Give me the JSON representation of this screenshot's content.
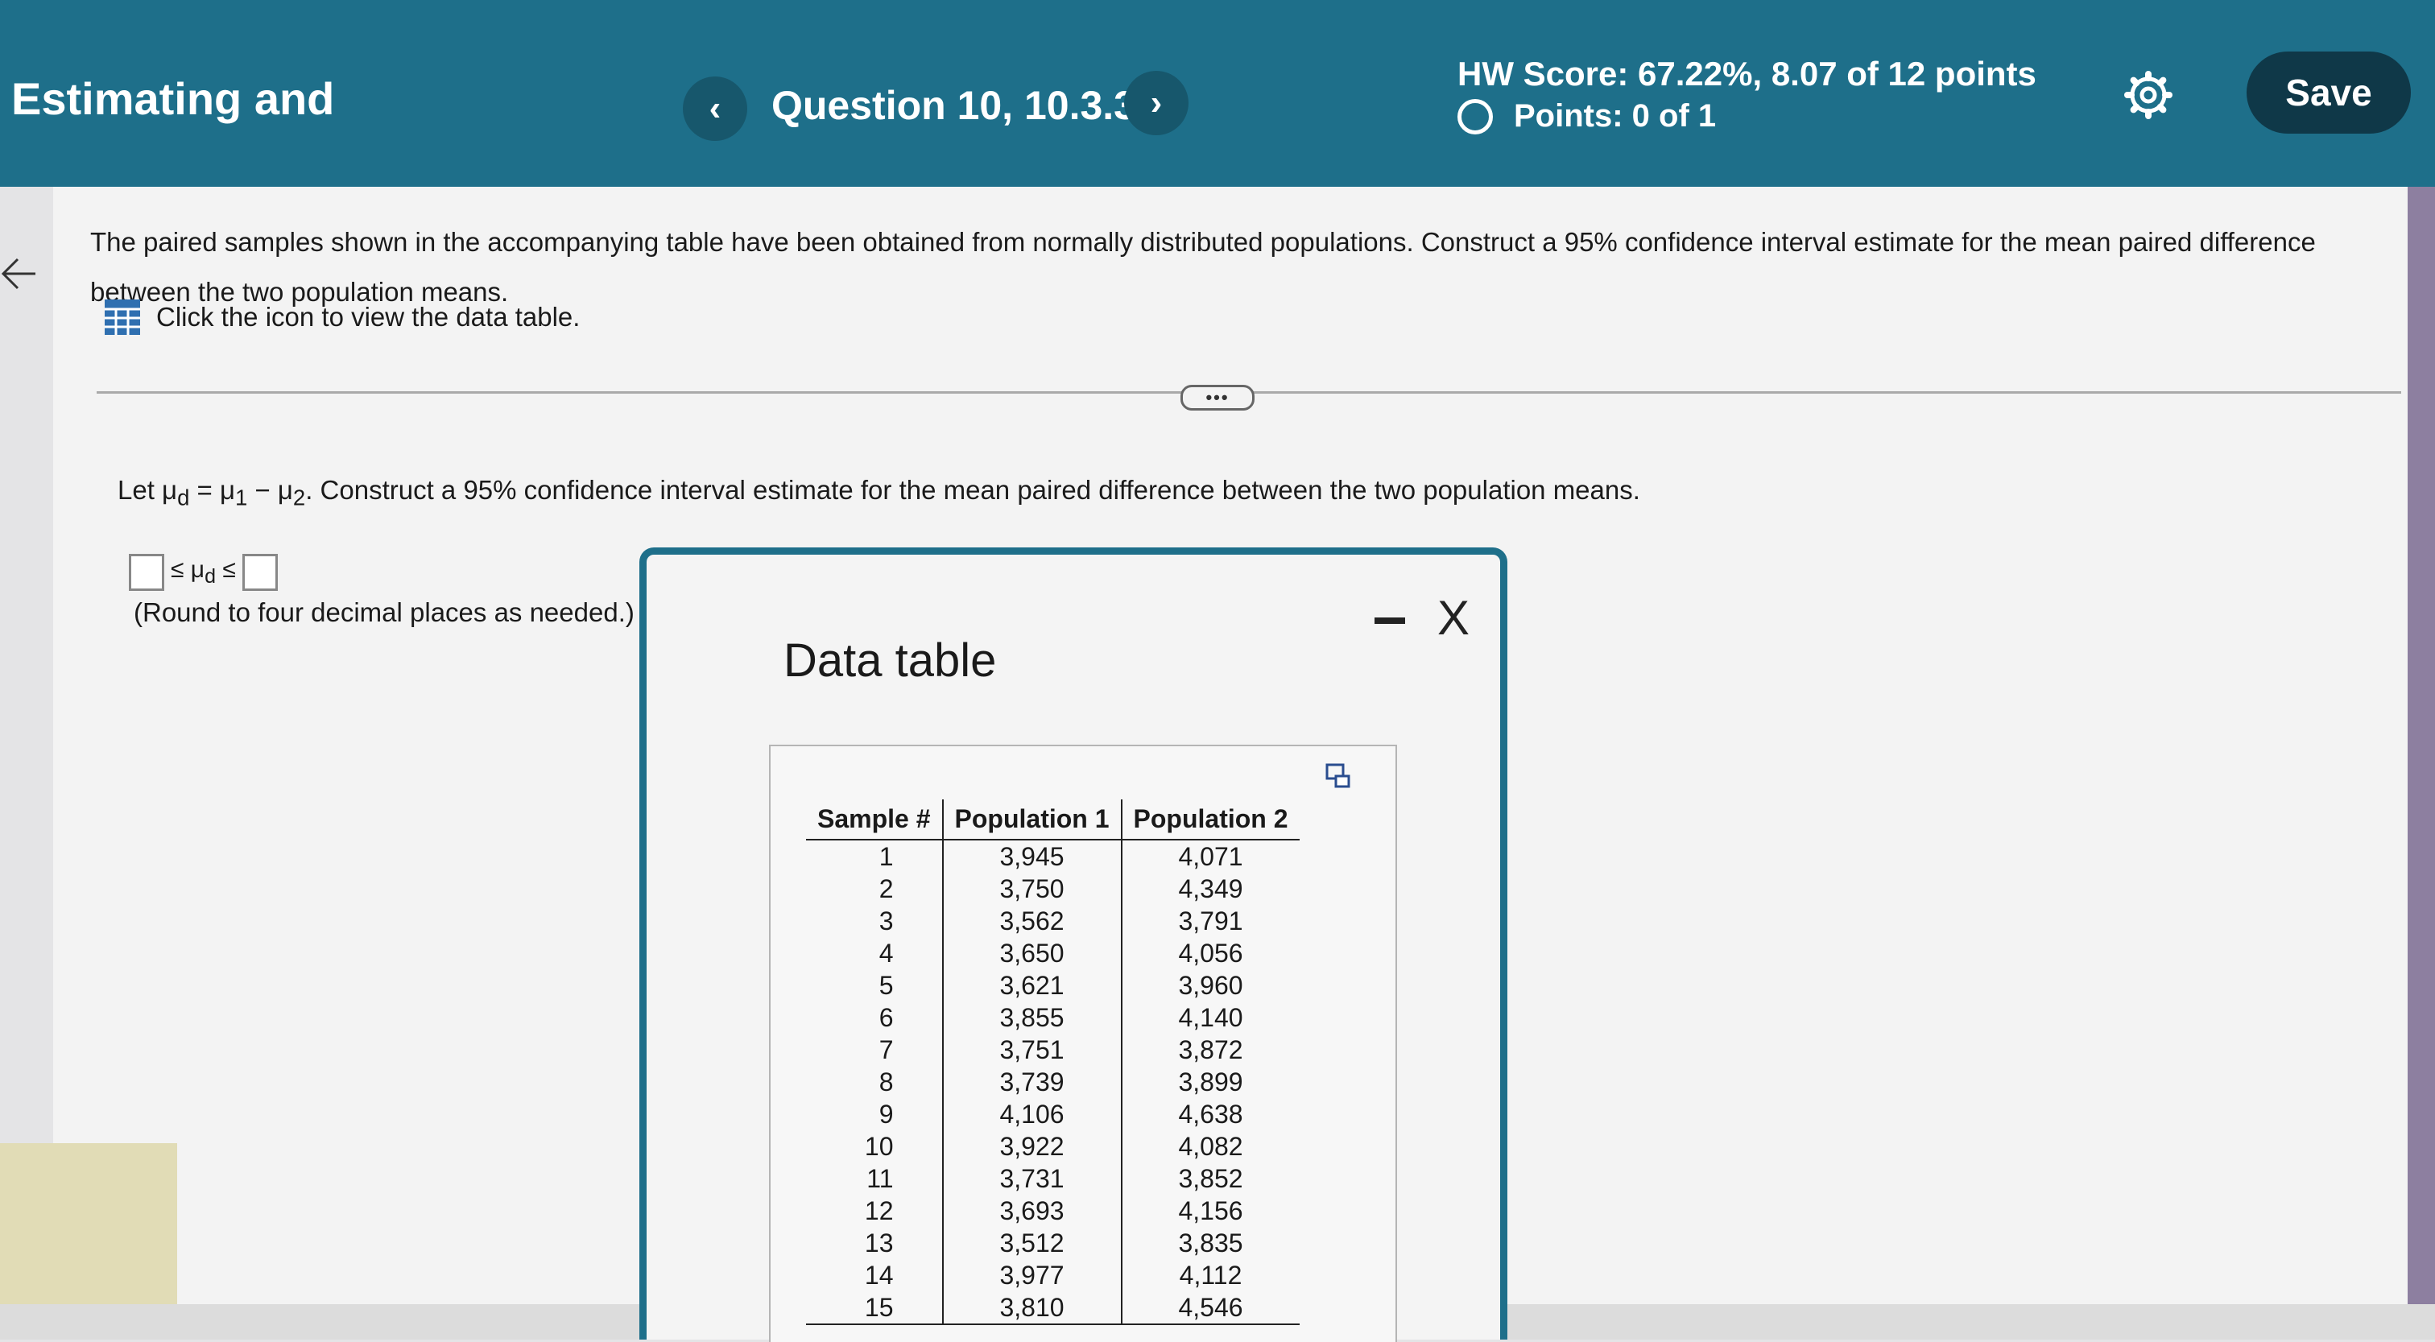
{
  "header": {
    "title": "Estimating and",
    "prev_icon": "‹",
    "next_icon": "›",
    "question": "Question 10, 10.3.37",
    "hw_score": "HW Score: 67.22%, 8.07 of 12 points",
    "points": "Points: 0 of 1",
    "save_label": "Save",
    "settings_icon": "gear-icon",
    "colors": {
      "bar": "#1e6f8a",
      "save": "#0f3848"
    }
  },
  "content": {
    "prompt": "The paired samples shown in the accompanying table have been obtained from normally distributed populations. Construct a 95% confidence interval estimate for the mean paired difference between the two population means.",
    "data_link": "Click the icon to view the data table.",
    "more_label": "•••",
    "instruction_prefix": "Let μ",
    "instruction_sub_d": "d",
    "instruction_eq": " = μ",
    "instruction_sub_1": "1",
    "instruction_minus": " − μ",
    "instruction_sub_2": "2",
    "instruction_rest": ". Construct a 95% confidence interval estimate for the mean paired difference between the two population means.",
    "answer_mid": "≤ μ",
    "answer_sub": "d",
    "answer_end": " ≤",
    "round_note": "(Round to four decimal places as needed.)"
  },
  "dialog": {
    "title": "Data table",
    "minimize_icon": "minimize-icon",
    "close_label": "X",
    "columns": [
      "Sample #",
      "Population 1",
      "Population 2"
    ],
    "rows": [
      [
        "1",
        "3,945",
        "4,071"
      ],
      [
        "2",
        "3,750",
        "4,349"
      ],
      [
        "3",
        "3,562",
        "3,791"
      ],
      [
        "4",
        "3,650",
        "4,056"
      ],
      [
        "5",
        "3,621",
        "3,960"
      ],
      [
        "6",
        "3,855",
        "4,140"
      ],
      [
        "7",
        "3,751",
        "3,872"
      ],
      [
        "8",
        "3,739",
        "3,899"
      ],
      [
        "9",
        "4,106",
        "4,638"
      ],
      [
        "10",
        "3,922",
        "4,082"
      ],
      [
        "11",
        "3,731",
        "3,852"
      ],
      [
        "12",
        "3,693",
        "4,156"
      ],
      [
        "13",
        "3,512",
        "3,835"
      ],
      [
        "14",
        "3,977",
        "4,112"
      ],
      [
        "15",
        "3,810",
        "4,546"
      ]
    ]
  }
}
